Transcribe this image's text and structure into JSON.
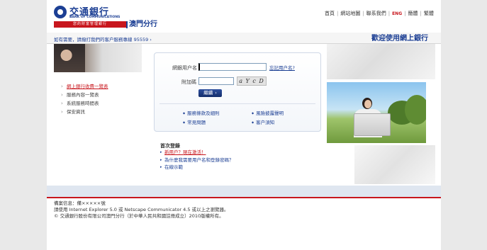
{
  "brand": {
    "name_cn": "交通銀行",
    "name_en": "BANK OF COMMUNICATIONS",
    "slogan": "您的財富管理銀行",
    "branch": "澳門分行"
  },
  "topnav": {
    "items": [
      "首頁",
      "網站地圖",
      "聯系我們"
    ],
    "lang_eng": "ENG",
    "lang_simplified": "簡體",
    "lang_traditional": "繁體"
  },
  "subbar": {
    "hotline": "如有需要，請撥打我們的客户服務專線 95559 ›",
    "welcome": "歡迎使用網上銀行"
  },
  "left_menu": [
    "網上銀行收費一覽表",
    "服務內容一覽表",
    "系統服務時間表",
    "保安資訊"
  ],
  "login": {
    "username_label": "網銀用户名",
    "username_value": "",
    "forgot_link": "忘記用户名?",
    "code_label": "附加碼",
    "code_value": "",
    "captcha_text": "a Y c D",
    "next_button": "繼續",
    "links": [
      "服務條款及細則",
      "風險披露聲明",
      "常見問題",
      "客户須知"
    ]
  },
  "first_login": {
    "title": "首次登錄",
    "items": [
      "新用户？現在激活！",
      "為什麼我需要用户名和登錄密碼？",
      "在線示範"
    ]
  },
  "footer": {
    "lines": [
      "備案信息：備×××××號",
      "請使用 Internet Explorer 5.0 或 Netscape Communicator 4.5 或以上之瀏覽器。",
      "© 交通銀行股份有限公司澳門分行（於中華人民共和國註冊成立）2010版權所有。"
    ]
  },
  "colors": {
    "brand_blue": "#1c3f94",
    "brand_red": "#c8161d"
  }
}
